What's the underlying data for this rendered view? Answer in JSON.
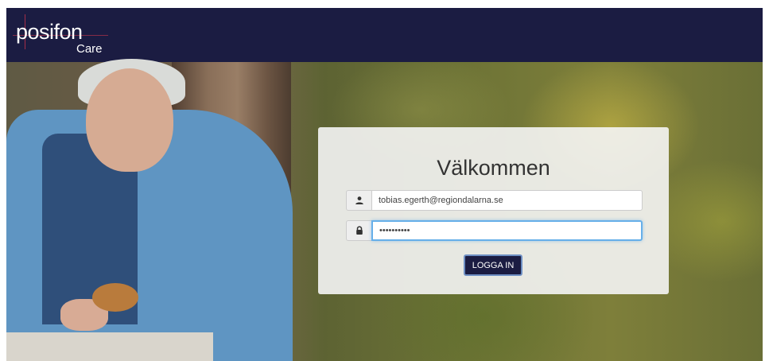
{
  "brand": {
    "name": "posifon",
    "product": "Care",
    "header_color": "#1b1c42"
  },
  "login": {
    "title": "Välkommen",
    "username": {
      "value": "tobias.egerth@regiondalarna.se",
      "icon": "user-icon"
    },
    "password": {
      "value": "••••••••••",
      "icon": "lock-icon"
    },
    "submit_label": "LOGGA IN",
    "accent_color": "#66afe9"
  }
}
